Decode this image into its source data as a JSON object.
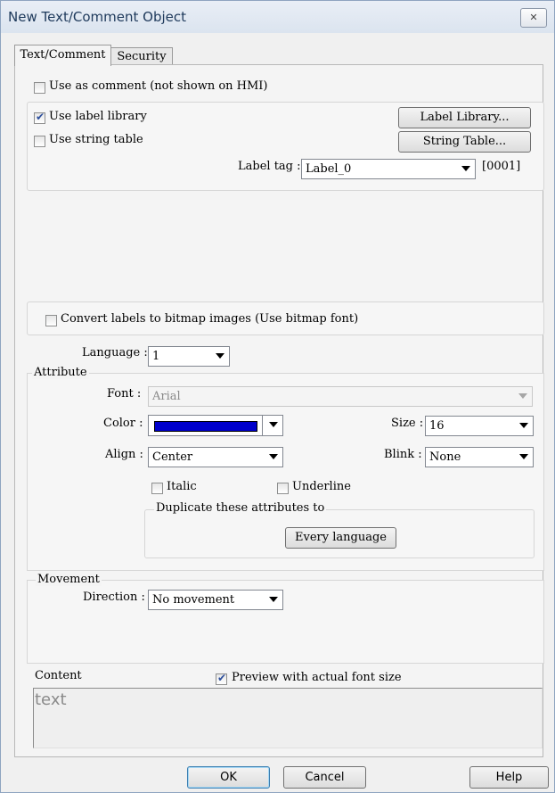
{
  "window": {
    "title": "New Text/Comment Object"
  },
  "tabs": [
    {
      "label": "Text/Comment"
    },
    {
      "label": "Security"
    }
  ],
  "options": {
    "use_as_comment": {
      "label": "Use as comment (not shown on HMI)",
      "checked": false
    },
    "use_label_library": {
      "label": "Use label library",
      "checked": true
    },
    "use_string_table": {
      "label": "Use string table",
      "checked": false
    },
    "label_library_button": "Label Library...",
    "string_table_button": "String Table...",
    "label_tag": {
      "label": "Label tag :",
      "value": "Label_0",
      "code": "[0001]"
    },
    "convert_bitmap": {
      "label": "Convert labels to bitmap images (Use bitmap font)",
      "checked": false
    }
  },
  "language": {
    "label": "Language :",
    "value": "1"
  },
  "attribute": {
    "title": "Attribute",
    "font": {
      "label": "Font :",
      "value": "Arial"
    },
    "color": {
      "label": "Color :",
      "value": "#0000cc"
    },
    "size": {
      "label": "Size :",
      "value": "16"
    },
    "align": {
      "label": "Align :",
      "value": "Center"
    },
    "blink": {
      "label": "Blink :",
      "value": "None"
    },
    "italic": {
      "label": "Italic",
      "checked": false
    },
    "underline": {
      "label": "Underline",
      "checked": false
    },
    "duplicate": {
      "title": "Duplicate these attributes to",
      "button": "Every language"
    }
  },
  "movement": {
    "title": "Movement",
    "direction": {
      "label": "Direction :",
      "value": "No movement"
    }
  },
  "content": {
    "label": "Content",
    "preview": {
      "label": "Preview with actual font size",
      "checked": true
    },
    "text": "text"
  },
  "footer": {
    "ok": "OK",
    "cancel": "Cancel",
    "help": "Help"
  }
}
